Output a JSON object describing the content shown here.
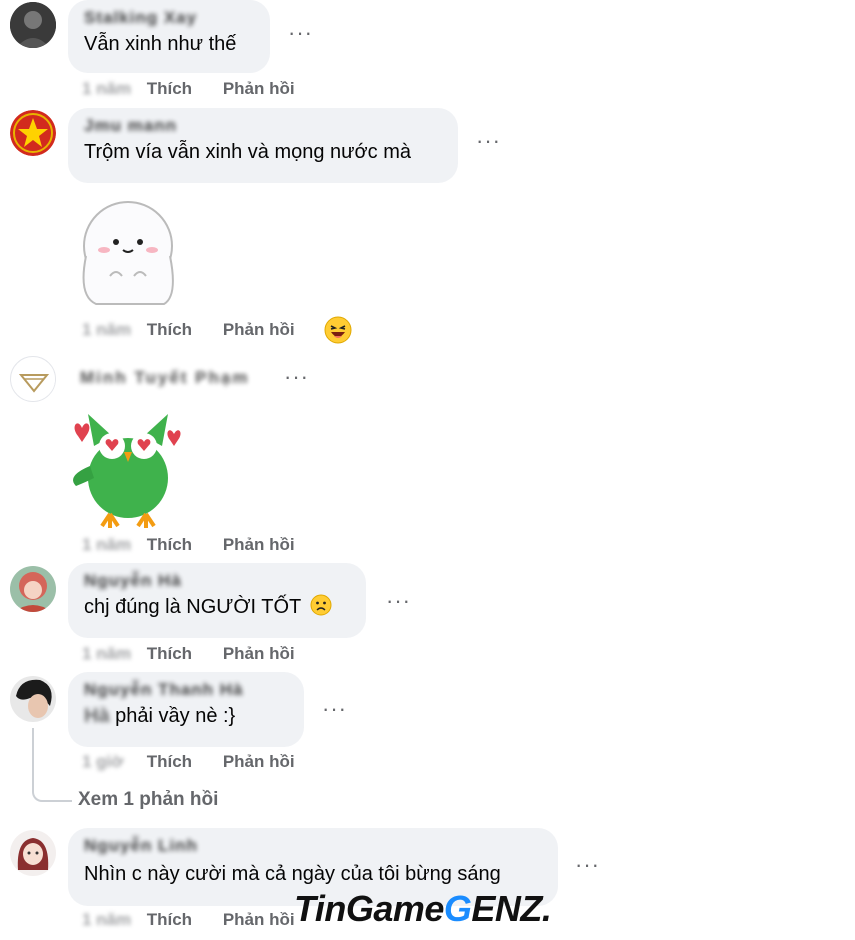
{
  "comments": [
    {
      "name": "Stalking Xay",
      "text": "Vẫn xinh như thế",
      "time": "1 năm"
    },
    {
      "name": "Jmu mann",
      "text": "Trộm vía vẫn xinh và mọng nước mà",
      "time": "1 năm"
    },
    {
      "name": "Minh Tuyết Phạm",
      "text": "",
      "time": "1 năm"
    },
    {
      "name": "Nguyễn Hà",
      "text": "chj đúng là NGƯỜI TỐT",
      "time": "1 năm"
    },
    {
      "name": "Nguyễn Thanh Hà",
      "text": "phải vầy nè :}",
      "mention": "Hà",
      "time": "1 giờ",
      "see_replies": "Xem 1 phản hồi"
    },
    {
      "name": "Nguyễn Linh",
      "text": "Nhìn c này cười mà cả ngày của tôi bừng sáng",
      "time": "1 năm"
    }
  ],
  "actions": {
    "like": "Thích",
    "reply": "Phản hồi",
    "more": "···"
  },
  "watermark": {
    "part1": "TinGame",
    "part2": "G",
    "part3": "ENZ",
    "dot": "."
  },
  "colors": {
    "bubble": "#f0f2f5",
    "muted": "#65676b",
    "watermark_accent": "#1a8cff"
  }
}
